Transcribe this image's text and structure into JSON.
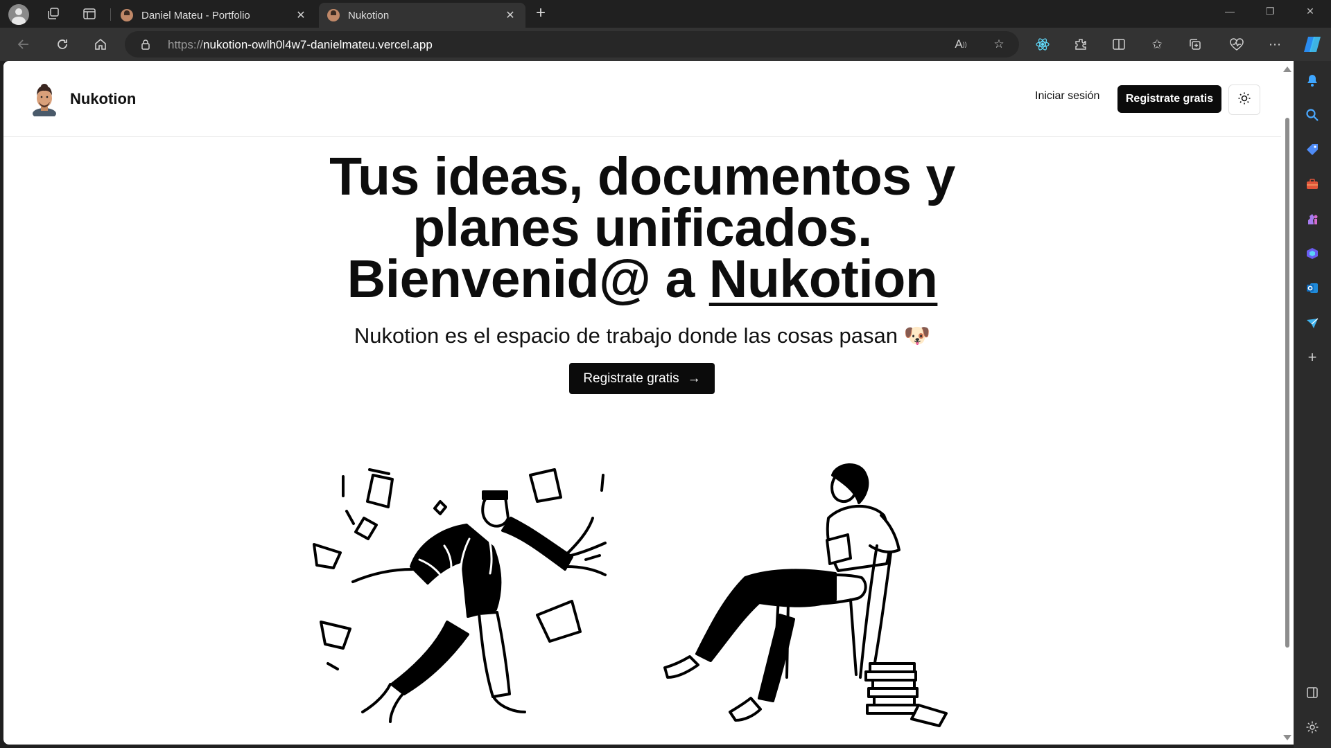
{
  "browser": {
    "tabs": [
      {
        "title": "Daniel Mateu - Portfolio",
        "active": false
      },
      {
        "title": "Nukotion",
        "active": true
      }
    ],
    "address": {
      "scheme": "https://",
      "host": "nukotion-owlh0l4w7-danielmateu.vercel.app"
    }
  },
  "site": {
    "brand": "Nukotion",
    "nav": {
      "login": "Iniciar sesión",
      "signup": "Registrate gratis"
    },
    "hero": {
      "title_line1": "Tus ideas, documentos y",
      "title_line2": "planes unificados.",
      "title_line3_prefix": "Bienvenid@ a",
      "title_line3_brand": "Nukotion",
      "subtitle": "Nukotion es el espacio de trabajo donde las cosas pasan 🐶",
      "cta": "Registrate gratis",
      "cta_arrow": "→"
    }
  },
  "colors": {
    "primary": "#0b0b0b",
    "background": "#ffffff",
    "chrome_dark": "#202020",
    "chrome_toolbar": "#333333"
  }
}
